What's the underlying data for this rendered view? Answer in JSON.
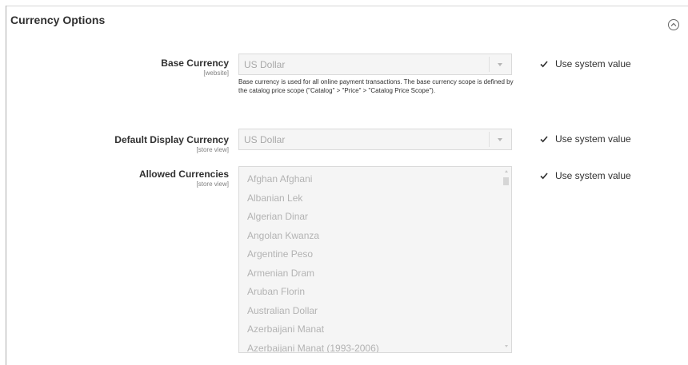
{
  "section": {
    "title": "Currency Options",
    "collapse_icon": "circle-chevron-up-icon"
  },
  "base_currency": {
    "label": "Base Currency",
    "scope": "[website]",
    "value": "US Dollar",
    "note": "Base currency is used for all online payment transactions. The base currency scope is defined by the catalog price scope (\"Catalog\" > \"Price\" > \"Catalog Price Scope\").",
    "use_system_value": "Use system value",
    "use_system_checked": true
  },
  "default_display_currency": {
    "label": "Default Display Currency",
    "scope": "[store view]",
    "value": "US Dollar",
    "use_system_value": "Use system value",
    "use_system_checked": true
  },
  "allowed_currencies": {
    "label": "Allowed Currencies",
    "scope": "[store view]",
    "options": [
      "Afghan Afghani",
      "Albanian Lek",
      "Algerian Dinar",
      "Angolan Kwanza",
      "Argentine Peso",
      "Armenian Dram",
      "Aruban Florin",
      "Australian Dollar",
      "Azerbaijani Manat",
      "Azerbaijani Manat (1993-2006)"
    ],
    "use_system_value": "Use system value",
    "use_system_checked": true
  },
  "colors": {
    "checkmark": "#303030",
    "disabled_bg": "#f5f5f5",
    "disabled_text": "#a9a9a9"
  }
}
